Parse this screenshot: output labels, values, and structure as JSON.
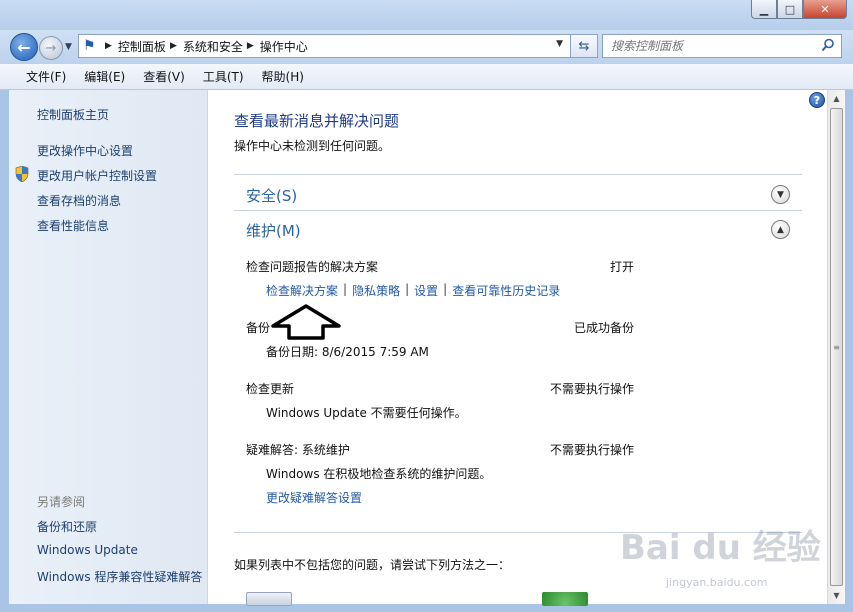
{
  "window": {
    "minimize_icon": "minimize-icon",
    "maximize_icon": "maximize-icon",
    "close_icon": "close-icon"
  },
  "address": {
    "breadcrumbs": [
      "控制面板",
      "系统和安全",
      "操作中心"
    ]
  },
  "search": {
    "placeholder": "搜索控制面板"
  },
  "menu": [
    "文件(F)",
    "编辑(E)",
    "查看(V)",
    "工具(T)",
    "帮助(H)"
  ],
  "sidebar": {
    "links": [
      "控制面板主页",
      "更改操作中心设置",
      "更改用户帐户控制设置",
      "查看存档的消息",
      "查看性能信息"
    ],
    "see_also_title": "另请参阅",
    "see_also": [
      "备份和还原",
      "Windows Update",
      "Windows 程序兼容性疑难解答"
    ]
  },
  "main": {
    "title": "查看最新消息并解决问题",
    "subtitle": "操作中心未检测到任何问题。",
    "security": {
      "title": "安全(S)"
    },
    "maintenance": {
      "title": "维护(M)",
      "items": [
        {
          "title": "检查问题报告的解决方案",
          "status": "打开"
        },
        {
          "title": "备份",
          "status": "已成功备份",
          "detail": "备份日期: 8/6/2015 7:59 AM"
        },
        {
          "title": "检查更新",
          "status": "不需要执行操作",
          "detail": "Windows Update 不需要任何操作。"
        },
        {
          "title": "疑难解答: 系统维护",
          "status": "不需要执行操作",
          "detail": "Windows 在积极地检查系统的维护问题。"
        }
      ],
      "report_links": [
        "检查解决方案",
        "隐私策略",
        "设置",
        "查看可靠性历史记录"
      ],
      "troubleshoot_link": "更改疑难解答设置"
    },
    "footer": "如果列表中不包括您的问题，请尝试下列方法之一："
  },
  "watermark": "Bai du 经验",
  "watermark_sub": "jingyan.baidu.com"
}
